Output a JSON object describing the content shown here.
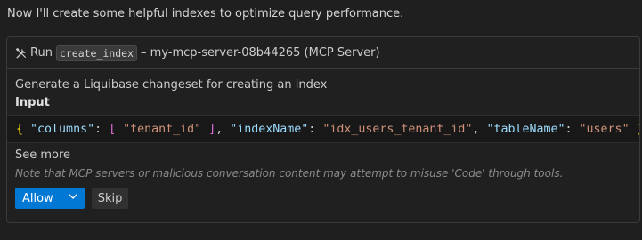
{
  "intro_text": "Now I'll create some helpful indexes to optimize query performance.",
  "tool_card": {
    "header": {
      "icon": "tools-icon",
      "run_label": "Run",
      "tool_name": "create_index",
      "suffix": "– my-mcp-server-08b44265 (MCP Server)"
    },
    "description": "Generate a Liquibase changeset for creating an index",
    "input_label": "Input",
    "input_json": {
      "open_brace": "{",
      "columns_key": "\"columns\"",
      "colon1": ": ",
      "open_bracket": "[",
      "columns_value": " \"tenant_id\" ",
      "close_bracket": "]",
      "comma1": ", ",
      "indexName_key": "\"indexName\"",
      "colon2": ": ",
      "indexName_value": "\"idx_users_tenant_id\"",
      "comma2": ", ",
      "tableName_key": "\"tableName\"",
      "colon3": ": ",
      "tableName_value": "\"users\"",
      "close_brace": "}"
    },
    "see_more_label": "See more",
    "note": "Note that MCP servers or malicious conversation content may attempt to misuse 'Code' through tools.",
    "allow_label": "Allow",
    "allow_dropdown_icon": "chevron-down-icon",
    "skip_label": "Skip"
  },
  "colors": {
    "background": "#1f1f1f",
    "accent": "#0078d4",
    "json_key": "#9cdcfe",
    "json_string": "#ce9178",
    "json_brace": "#ffd700",
    "json_bracket": "#da70d6"
  }
}
